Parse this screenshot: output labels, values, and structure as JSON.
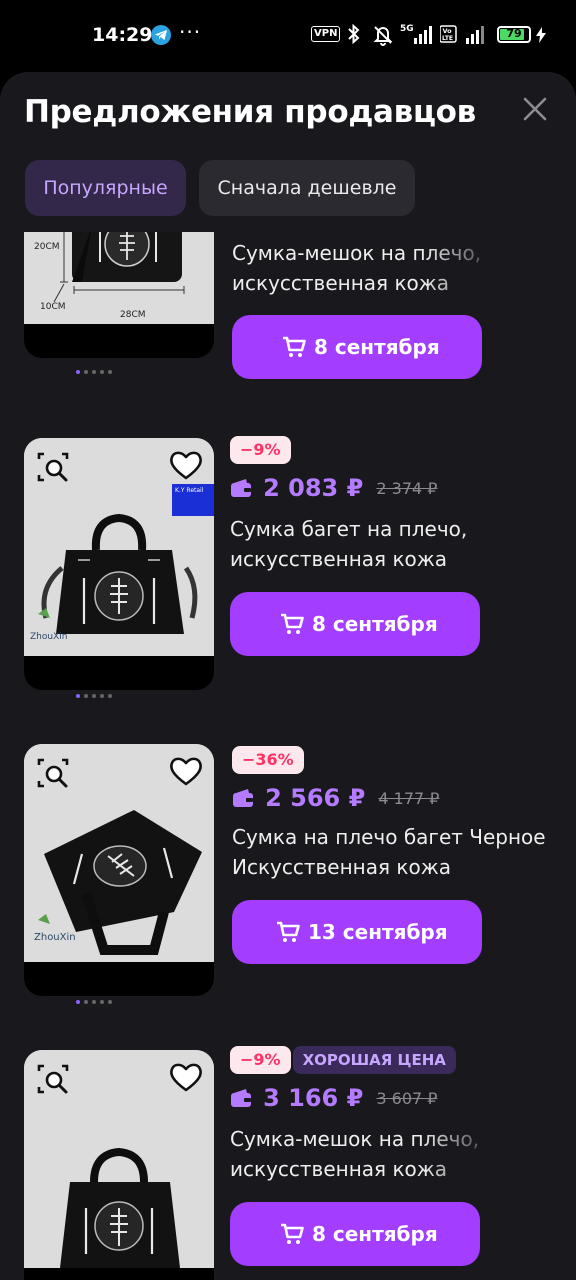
{
  "status_bar": {
    "time": "14:29",
    "dots": "···",
    "vpn": "VPN",
    "network": "5G",
    "volte": "Vo LTE",
    "battery": "79",
    "icons": [
      "telegram-icon",
      "bluetooth-icon",
      "bell-off-icon",
      "signal-icon",
      "charging-icon"
    ]
  },
  "sheet": {
    "title": "Предложения продавцов",
    "tabs": [
      {
        "label": "Популярные",
        "active": true
      },
      {
        "label": "Сначала дешевле",
        "active": false
      }
    ]
  },
  "colors": {
    "sheet_bg": "#19181d",
    "accent": "#a33dff",
    "price": "#b47bff",
    "discount_text": "#ff3366",
    "discount_bg": "#fde8ee",
    "tab_active_bg": "#34284a",
    "tab_active_text": "#c6a6ff"
  },
  "offers": [
    {
      "title": "Сумка-мешок на плечо, искусственная кожа",
      "delivery": "8 сентября",
      "image_labels": {
        "height": "20CM",
        "depth": "10CM",
        "width": "28CM"
      },
      "image_count": 5,
      "active_image": 0
    },
    {
      "discount": "−9%",
      "price": "2 083 ₽",
      "old_price": "2 374 ₽",
      "title": "Сумка багет на плечо, искусственная кожа",
      "delivery": "8 сентября",
      "image_labels": {
        "store_tag": "K.Y Retail",
        "brand": "ZhouXin"
      },
      "image_count": 5,
      "active_image": 0
    },
    {
      "discount": "−36%",
      "price": "2 566 ₽",
      "old_price": "4 177 ₽",
      "title": "Сумка на плечо багет Черное Искусственная кожа",
      "delivery": "13 сентября",
      "image_labels": {
        "brand": "ZhouXin"
      },
      "image_count": 5,
      "active_image": 0
    },
    {
      "discount": "−9%",
      "badge": "ХОРОШАЯ ЦЕНА",
      "price": "3 166 ₽",
      "old_price": "3 607 ₽",
      "title": "Сумка-мешок на плечо, искусственная кожа",
      "delivery": "8 сентября"
    }
  ]
}
